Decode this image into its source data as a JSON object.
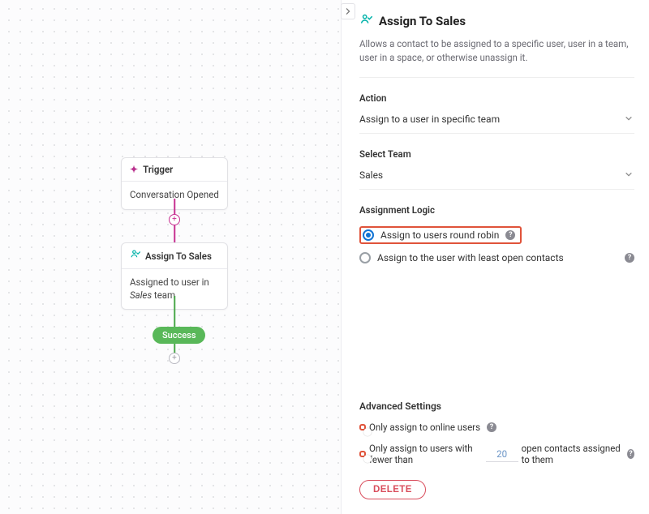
{
  "canvas": {
    "trigger": {
      "header": "Trigger",
      "body": "Conversation Opened"
    },
    "assign_node": {
      "header": "Assign To Sales",
      "body_prefix": "Assigned to user in ",
      "body_italic": "Sales",
      "body_suffix": " team"
    },
    "success_label": "Success"
  },
  "panel": {
    "title": "Assign To Sales",
    "description": "Allows a contact to be assigned to a specific user, user in a team, user in a space, or otherwise unassign it.",
    "action_label": "Action",
    "action_value": "Assign to a user in specific team",
    "team_label": "Select Team",
    "team_value": "Sales",
    "logic_label": "Assignment Logic",
    "logic_options": {
      "round_robin": "Assign to users round robin",
      "least_open": "Assign to the user with least open contacts"
    },
    "advanced_heading": "Advanced Settings",
    "online_only_label": "Only assign to online users",
    "fewer_than_prefix": "Only assign to users with fewer than",
    "fewer_than_value": "20",
    "fewer_than_suffix": "open contacts assigned to them",
    "delete_label": "DELETE"
  }
}
